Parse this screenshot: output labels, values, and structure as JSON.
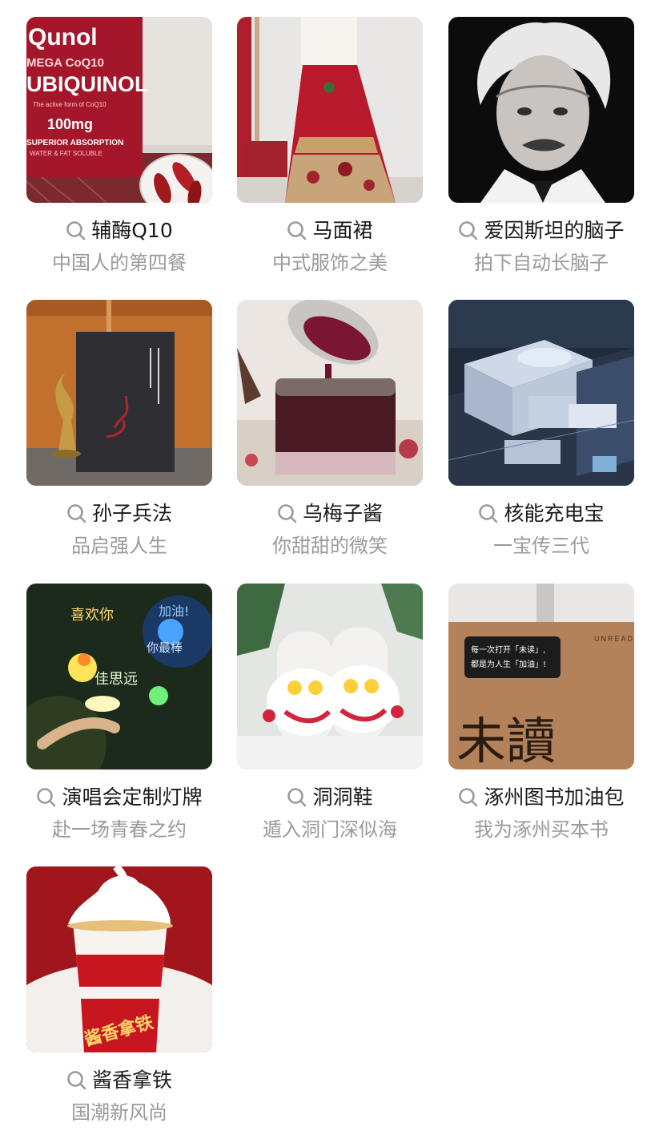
{
  "items": [
    {
      "title": "辅酶Q10",
      "subtitle": "中国人的第四餐",
      "image": "coq10-supplement-bottle-image"
    },
    {
      "title": "马面裙",
      "subtitle": "中式服饰之美",
      "image": "mamian-skirt-image"
    },
    {
      "title": "爱因斯坦的脑子",
      "subtitle": "拍下自动长脑子",
      "image": "einstein-portrait-image"
    },
    {
      "title": "孙子兵法",
      "subtitle": "品启强人生",
      "image": "art-of-war-book-image"
    },
    {
      "title": "乌梅子酱",
      "subtitle": "你甜甜的微笑",
      "image": "plum-jam-jar-image"
    },
    {
      "title": "核能充电宝",
      "subtitle": "一宝传三代",
      "image": "nuclear-plant-model-image"
    },
    {
      "title": "演唱会定制灯牌",
      "subtitle": "赴一场青春之约",
      "image": "concert-light-sign-image"
    },
    {
      "title": "洞洞鞋",
      "subtitle": "遁入洞门深似海",
      "image": "lion-dance-clogs-image"
    },
    {
      "title": "涿州图书加油包",
      "subtitle": "我为涿州买本书",
      "image": "book-box-image"
    },
    {
      "title": "酱香拿铁",
      "subtitle": "国潮新风尚",
      "image": "sauce-latte-cup-image"
    }
  ],
  "image_text": {
    "qunol": "Qunol",
    "mega_coq10": "MEGA CoQ10",
    "ubiquinol": "UBIQUINOL",
    "active_form": "The active form of CoQ10",
    "dose": "100mg",
    "absorption": "SUPERIOR ABSORPTION",
    "soluble": "WATER & FAT SOLUBLE",
    "box_slogan_1": "每一次打开「未读」,",
    "box_slogan_2": "都是为人生「加油」!",
    "box_brand": "UNREAD",
    "box_big_text": "未讀",
    "latte_text": "酱香拿铁",
    "sign_text_1": "喜欢你",
    "sign_text_2": "加油!",
    "sign_text_3": "你最棒",
    "sign_text_4": "佳思远"
  },
  "colors": {
    "title": "#1a1a1a",
    "subtitle": "#9a9a9a",
    "icon": "#9a9a9a",
    "background": "#ffffff"
  }
}
